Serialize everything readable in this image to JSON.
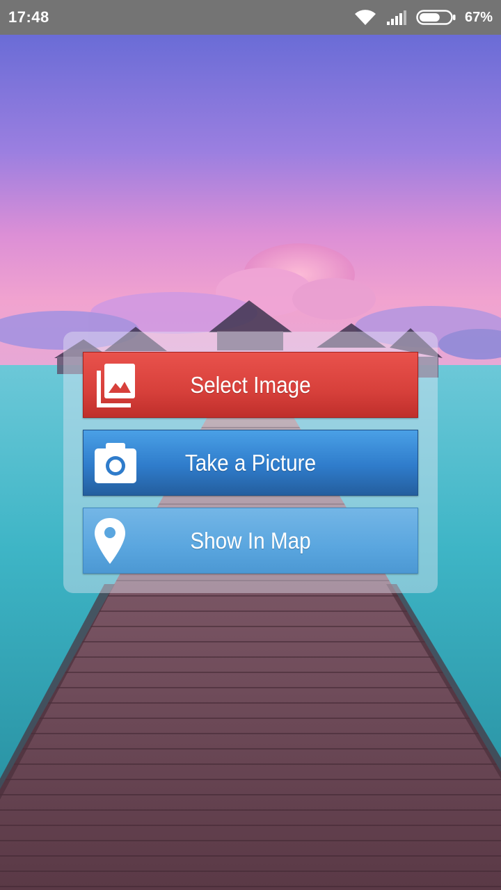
{
  "status_bar": {
    "time": "17:48",
    "battery_percent": "67%",
    "battery_level": 0.67,
    "icons": [
      "wifi-icon",
      "signal-icon",
      "battery-icon"
    ]
  },
  "background": {
    "scene": "overwater-bungalows-pier-at-dusk",
    "colors": {
      "sky_top": "#6f6fd6",
      "sky_pink": "#e58fd1",
      "sea": "#3fb6c6",
      "pier": "#6d4a5a"
    }
  },
  "menu": {
    "buttons": [
      {
        "label": "Select Image",
        "icon": "gallery-icon",
        "color": "#d7403b"
      },
      {
        "label": "Take a Picture",
        "icon": "camera-icon",
        "color": "#2f7ccb"
      },
      {
        "label": "Show In Map",
        "icon": "map-pin-icon",
        "color": "#5aa6df"
      }
    ]
  }
}
